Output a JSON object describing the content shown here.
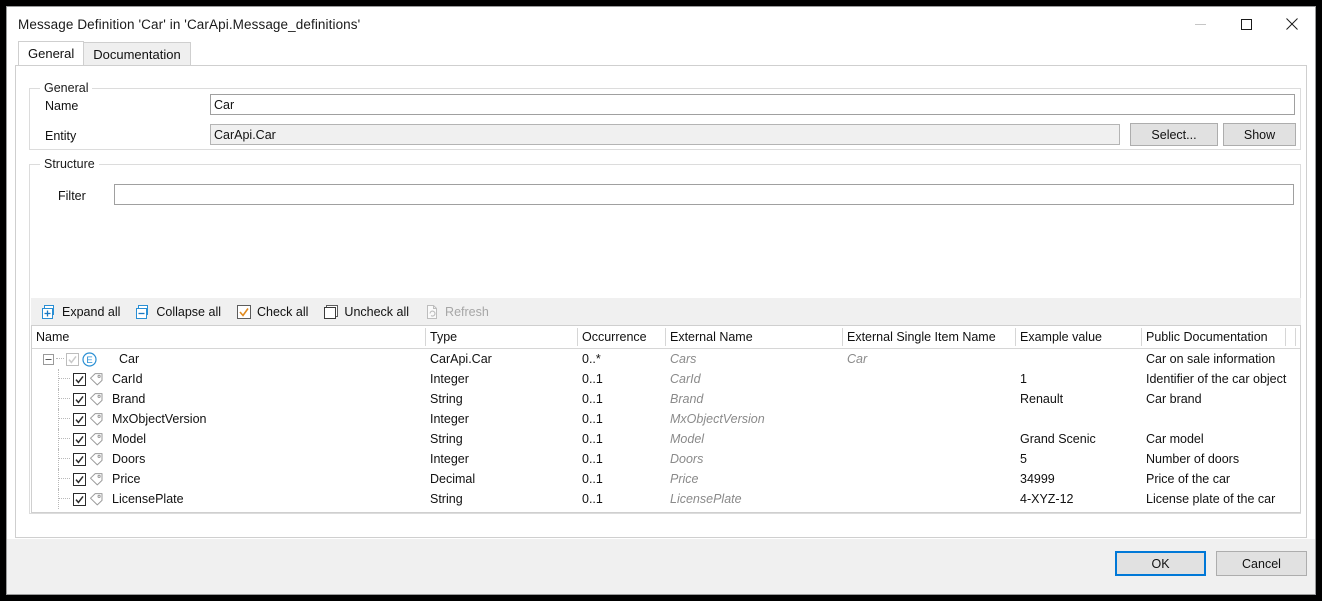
{
  "window": {
    "title": "Message Definition 'Car' in 'CarApi.Message_definitions'",
    "minimize_label": "minimize",
    "maximize_label": "maximize",
    "close_label": "close"
  },
  "tabs": [
    {
      "label": "General",
      "active": true
    },
    {
      "label": "Documentation",
      "active": false
    }
  ],
  "general": {
    "group_title": "General",
    "name_label": "Name",
    "name_value": "Car",
    "entity_label": "Entity",
    "entity_value": "CarApi.Car",
    "select_button": "Select...",
    "show_button": "Show"
  },
  "structure": {
    "group_title": "Structure",
    "filter_label": "Filter",
    "filter_value": "",
    "filter_placeholder": "",
    "toolbar": [
      {
        "label": "Expand all",
        "icon": "expand-all-icon",
        "disabled": false
      },
      {
        "label": "Collapse all",
        "icon": "collapse-all-icon",
        "disabled": false
      },
      {
        "label": "Check all",
        "icon": "check-all-icon",
        "disabled": false
      },
      {
        "label": "Uncheck all",
        "icon": "uncheck-all-icon",
        "disabled": false
      },
      {
        "label": "Refresh",
        "icon": "refresh-icon",
        "disabled": true
      }
    ],
    "columns": [
      "Name",
      "Type",
      "Occurrence",
      "External Name",
      "External Single Item Name",
      "Example value",
      "Public Documentation"
    ],
    "rows": [
      {
        "name": "Car",
        "level": 0,
        "icon": "entity-icon",
        "checked": true,
        "checkbox_enabled": false,
        "expanded": true,
        "type": "CarApi.Car",
        "occurrence": "0..*",
        "external_name": "Cars",
        "external_single_item_name": "Car",
        "example_value": "",
        "public_documentation": "Car on sale information"
      },
      {
        "name": "CarId",
        "level": 1,
        "icon": "attribute-icon",
        "checked": true,
        "checkbox_enabled": true,
        "type": "Integer",
        "occurrence": "0..1",
        "external_name": "CarId",
        "external_single_item_name": "",
        "example_value": "1",
        "public_documentation": "Identifier of the car object"
      },
      {
        "name": "Brand",
        "level": 1,
        "icon": "attribute-icon",
        "checked": true,
        "checkbox_enabled": true,
        "type": "String",
        "occurrence": "0..1",
        "external_name": "Brand",
        "external_single_item_name": "",
        "example_value": "Renault",
        "public_documentation": "Car brand"
      },
      {
        "name": "MxObjectVersion",
        "level": 1,
        "icon": "attribute-icon",
        "checked": true,
        "checkbox_enabled": true,
        "type": "Integer",
        "occurrence": "0..1",
        "external_name": "MxObjectVersion",
        "external_single_item_name": "",
        "example_value": "",
        "public_documentation": ""
      },
      {
        "name": "Model",
        "level": 1,
        "icon": "attribute-icon",
        "checked": true,
        "checkbox_enabled": true,
        "type": "String",
        "occurrence": "0..1",
        "external_name": "Model",
        "external_single_item_name": "",
        "example_value": "Grand Scenic",
        "public_documentation": "Car model"
      },
      {
        "name": "Doors",
        "level": 1,
        "icon": "attribute-icon",
        "checked": true,
        "checkbox_enabled": true,
        "type": "Integer",
        "occurrence": "0..1",
        "external_name": "Doors",
        "external_single_item_name": "",
        "example_value": "5",
        "public_documentation": "Number of doors"
      },
      {
        "name": "Price",
        "level": 1,
        "icon": "attribute-icon",
        "checked": true,
        "checkbox_enabled": true,
        "type": "Decimal",
        "occurrence": "0..1",
        "external_name": "Price",
        "external_single_item_name": "",
        "example_value": "34999",
        "public_documentation": "Price of the car"
      },
      {
        "name": "LicensePlate",
        "level": 1,
        "icon": "attribute-icon",
        "checked": true,
        "checkbox_enabled": true,
        "type": "String",
        "occurrence": "0..1",
        "external_name": "LicensePlate",
        "external_single_item_name": "",
        "example_value": "4-XYZ-12",
        "public_documentation": "License plate of the car"
      }
    ]
  },
  "footer": {
    "ok_label": "OK",
    "cancel_label": "Cancel"
  },
  "colors": {
    "accent": "#0078d7",
    "check_orange": "#e08a1e",
    "disabled_text": "#a6a6a6",
    "external_text": "#8a8a8a"
  }
}
